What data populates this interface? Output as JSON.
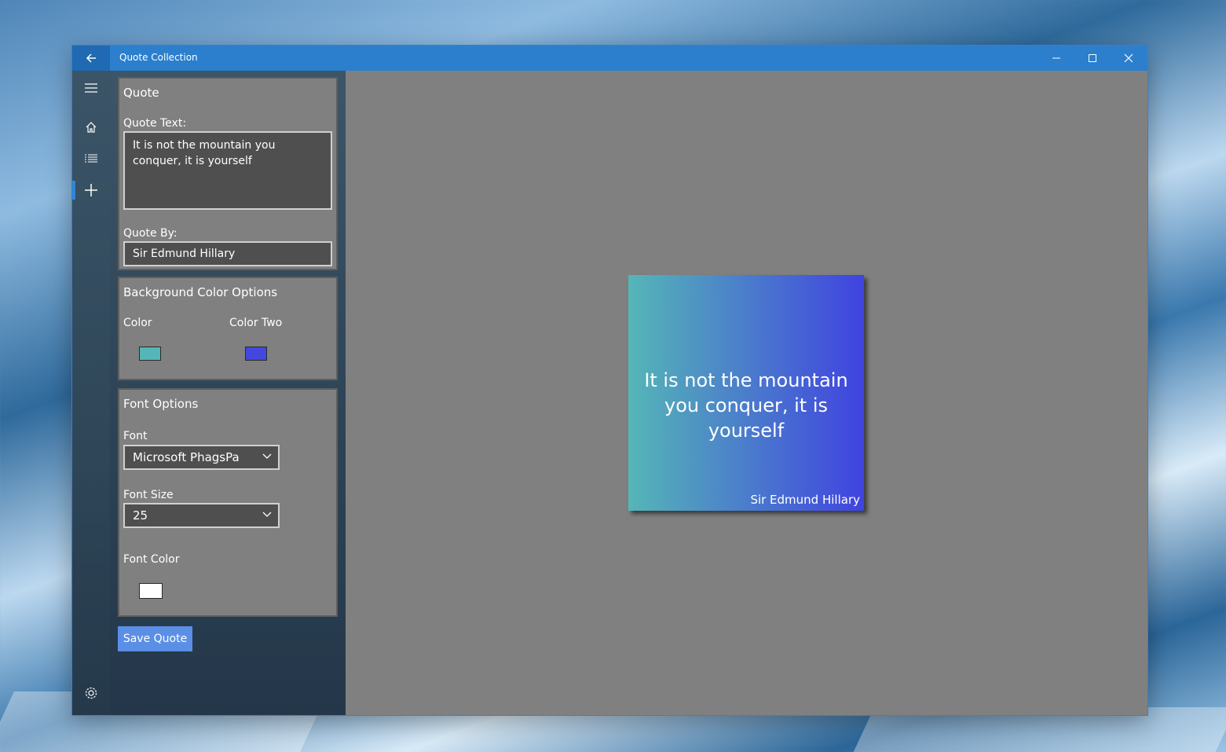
{
  "window": {
    "title": "Quote Collection",
    "controls": [
      "minimize",
      "maximize",
      "close"
    ]
  },
  "nav": {
    "items": [
      {
        "name": "hamburger-icon"
      },
      {
        "name": "home-icon"
      },
      {
        "name": "list-icon"
      },
      {
        "name": "add-icon",
        "active": true
      }
    ],
    "footer": {
      "name": "settings-icon"
    }
  },
  "quote_card": {
    "title": "Quote",
    "text_label": "Quote Text:",
    "text_value": "It is not the mountain you conquer, it is yourself",
    "by_label": "Quote By:",
    "by_value": "Sir Edmund Hillary"
  },
  "background_card": {
    "title": "Background Color Options",
    "color_label": "Color",
    "color_two_label": "Color Two",
    "color_value": "#55b6b7",
    "color_two_value": "#4347dd"
  },
  "font_card": {
    "title": "Font Options",
    "font_label": "Font",
    "font_value": "Microsoft PhagsPa",
    "size_label": "Font Size",
    "size_value": "25",
    "color_label": "Font Color",
    "color_value": "#ffffff"
  },
  "save_button": "Save Quote",
  "preview": {
    "quote": "It is not the mountain you conquer, it is yourself",
    "author": "Sir Edmund Hillary",
    "gradient_start": "#55b6b7",
    "gradient_end": "#4043e0",
    "text_color": "#ffffff"
  }
}
